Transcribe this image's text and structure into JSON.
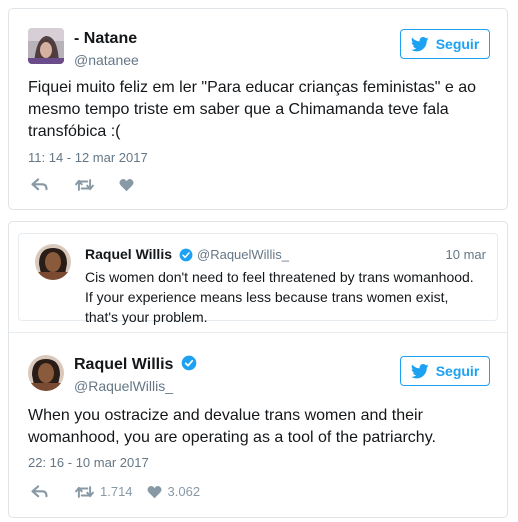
{
  "tweet1": {
    "name": "- Natane",
    "handle": "@natanee",
    "follow_label": "Seguir",
    "text": "Fiquei muito feliz em ler \"Para educar crianças feministas\" e ao mesmo tempo triste em saber que a Chimamanda teve fala transfóbica :(",
    "timestamp": "11: 14 - 12 mar 2017"
  },
  "quoted": {
    "name": "Raquel Willis",
    "handle": "@RaquelWillis_",
    "date": "10 mar",
    "text": "Cis women don't need to feel threatened by trans womanhood. If your experience means less because trans women exist, that's your problem."
  },
  "tweet2": {
    "name": "Raquel Willis",
    "handle": "@RaquelWillis_",
    "follow_label": "Seguir",
    "text": "When you ostracize and devalue trans women and their womanhood, you are operating as a tool of the patriarchy.",
    "timestamp": "22: 16 - 10 mar 2017",
    "retweets": "1.714",
    "likes": "3.062"
  },
  "colors": {
    "accent": "#1da1f2",
    "secondary_text": "#657786",
    "icon_gray": "#8899a6",
    "border": "#e6ecf0"
  },
  "icons": [
    "twitter-bird-icon",
    "reply-icon",
    "retweet-icon",
    "heart-icon",
    "verified-badge-icon"
  ]
}
